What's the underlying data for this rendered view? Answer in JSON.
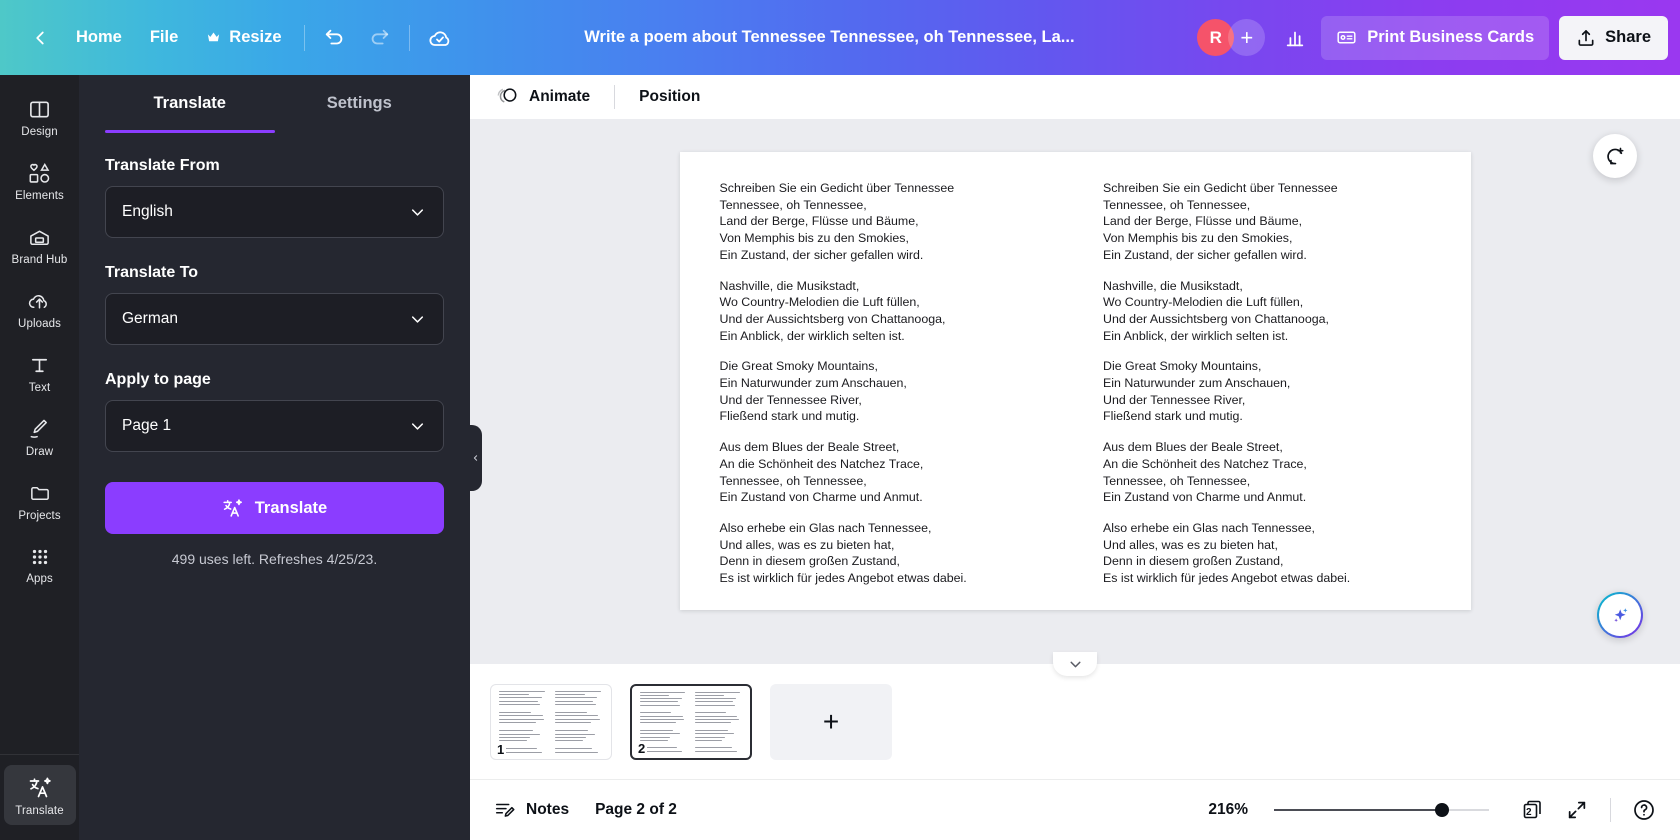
{
  "topbar": {
    "back_icon": "chevron-left-icon",
    "home_label": "Home",
    "file_label": "File",
    "resize_label": "Resize",
    "resize_icon": "crown-icon",
    "undo_icon": "undo-icon",
    "redo_icon": "redo-icon",
    "saved_icon": "cloud-check-icon",
    "title": "Write a poem about Tennessee Tennessee, oh Tennessee, La...",
    "avatar_initial": "R",
    "add_member_label": "+",
    "stats_icon": "bar-chart-icon",
    "print_label": "Print Business Cards",
    "print_icon": "id-card-icon",
    "share_label": "Share",
    "share_icon": "share-upload-icon",
    "accent_purple": "#8b3dff",
    "avatar_color": "#f5536a"
  },
  "rail": {
    "items": [
      {
        "label": "Design",
        "icon": "design-icon"
      },
      {
        "label": "Elements",
        "icon": "elements-icon"
      },
      {
        "label": "Brand Hub",
        "icon": "brand-hub-icon"
      },
      {
        "label": "Uploads",
        "icon": "upload-cloud-icon"
      },
      {
        "label": "Text",
        "icon": "text-icon"
      },
      {
        "label": "Draw",
        "icon": "draw-pen-icon"
      },
      {
        "label": "Projects",
        "icon": "folder-icon"
      },
      {
        "label": "Apps",
        "icon": "apps-grid-icon"
      }
    ],
    "active": {
      "label": "Translate",
      "icon": "translate-icon"
    }
  },
  "panel": {
    "tabs": [
      {
        "label": "Translate",
        "active": true
      },
      {
        "label": "Settings",
        "active": false
      }
    ],
    "translate_from_label": "Translate From",
    "translate_from_value": "English",
    "translate_to_label": "Translate To",
    "translate_to_value": "German",
    "apply_to_page_label": "Apply to page",
    "apply_to_page_value": "Page 1",
    "translate_button_label": "Translate",
    "translate_button_icon": "translate-icon",
    "usage_note": "499 uses left. Refreshes 4/25/23.",
    "collapse_icon": "chevron-left-icon"
  },
  "canvas_toolbar": {
    "animate_label": "Animate",
    "animate_icon": "animate-circles-icon",
    "position_label": "Position"
  },
  "document": {
    "columns": [
      {
        "stanzas": [
          [
            "Schreiben Sie ein Gedicht über Tennessee",
            "Tennessee, oh Tennessee,",
            "Land der Berge, Flüsse und Bäume,",
            "Von Memphis bis zu den Smokies,",
            "Ein Zustand, der sicher gefallen wird."
          ],
          [
            "Nashville, die Musikstadt,",
            "Wo Country-Melodien die Luft füllen,",
            "Und der Aussichtsberg von Chattanooga,",
            "Ein Anblick, der wirklich selten ist."
          ],
          [
            "Die Great Smoky Mountains,",
            "Ein Naturwunder zum Anschauen,",
            "Und der Tennessee River,",
            "Fließend stark und mutig."
          ],
          [
            "Aus dem Blues der Beale Street,",
            "An die Schönheit des Natchez Trace,",
            "Tennessee, oh Tennessee,",
            "Ein Zustand von Charme und Anmut."
          ],
          [
            "Also erhebe ein Glas nach Tennessee,",
            "Und alles, was es zu bieten hat,",
            "Denn in diesem großen Zustand,",
            "Es ist wirklich für jedes Angebot etwas dabei."
          ]
        ]
      },
      {
        "stanzas": [
          [
            "Schreiben Sie ein Gedicht über Tennessee",
            "Tennessee, oh Tennessee,",
            "Land der Berge, Flüsse und Bäume,",
            "Von Memphis bis zu den Smokies,",
            "Ein Zustand, der sicher gefallen wird."
          ],
          [
            "Nashville, die Musikstadt,",
            "Wo Country-Melodien die Luft füllen,",
            "Und der Aussichtsberg von Chattanooga,",
            "Ein Anblick, der wirklich selten ist."
          ],
          [
            "Die Great Smoky Mountains,",
            "Ein Naturwunder zum Anschauen,",
            "Und der Tennessee River,",
            "Fließend stark und mutig."
          ],
          [
            "Aus dem Blues der Beale Street,",
            "An die Schönheit des Natchez Trace,",
            "Tennessee, oh Tennessee,",
            "Ein Zustand von Charme und Anmut."
          ],
          [
            "Also erhebe ein Glas nach Tennessee,",
            "Und alles, was es zu bieten hat,",
            "Denn in diesem großen Zustand,",
            "Es ist wirklich für jedes Angebot etwas dabei."
          ]
        ]
      }
    ],
    "comment_fab_icon": "add-comment-icon",
    "magic_fab_icon": "magic-sparkle-icon",
    "scroll_down_icon": "chevron-down-icon"
  },
  "thumbnails": {
    "pages": [
      {
        "number": "1",
        "selected": false
      },
      {
        "number": "2",
        "selected": true
      }
    ],
    "add_page_label": "+"
  },
  "bottombar": {
    "notes_label": "Notes",
    "notes_icon": "notes-icon",
    "page_indicator": "Page 2 of 2",
    "zoom_value": "216%",
    "zoom_percent": 78,
    "pages_icon": "pages-stack-icon",
    "pages_count": "2",
    "fullscreen_icon": "expand-arrows-icon",
    "help_icon": "help-question-icon"
  }
}
